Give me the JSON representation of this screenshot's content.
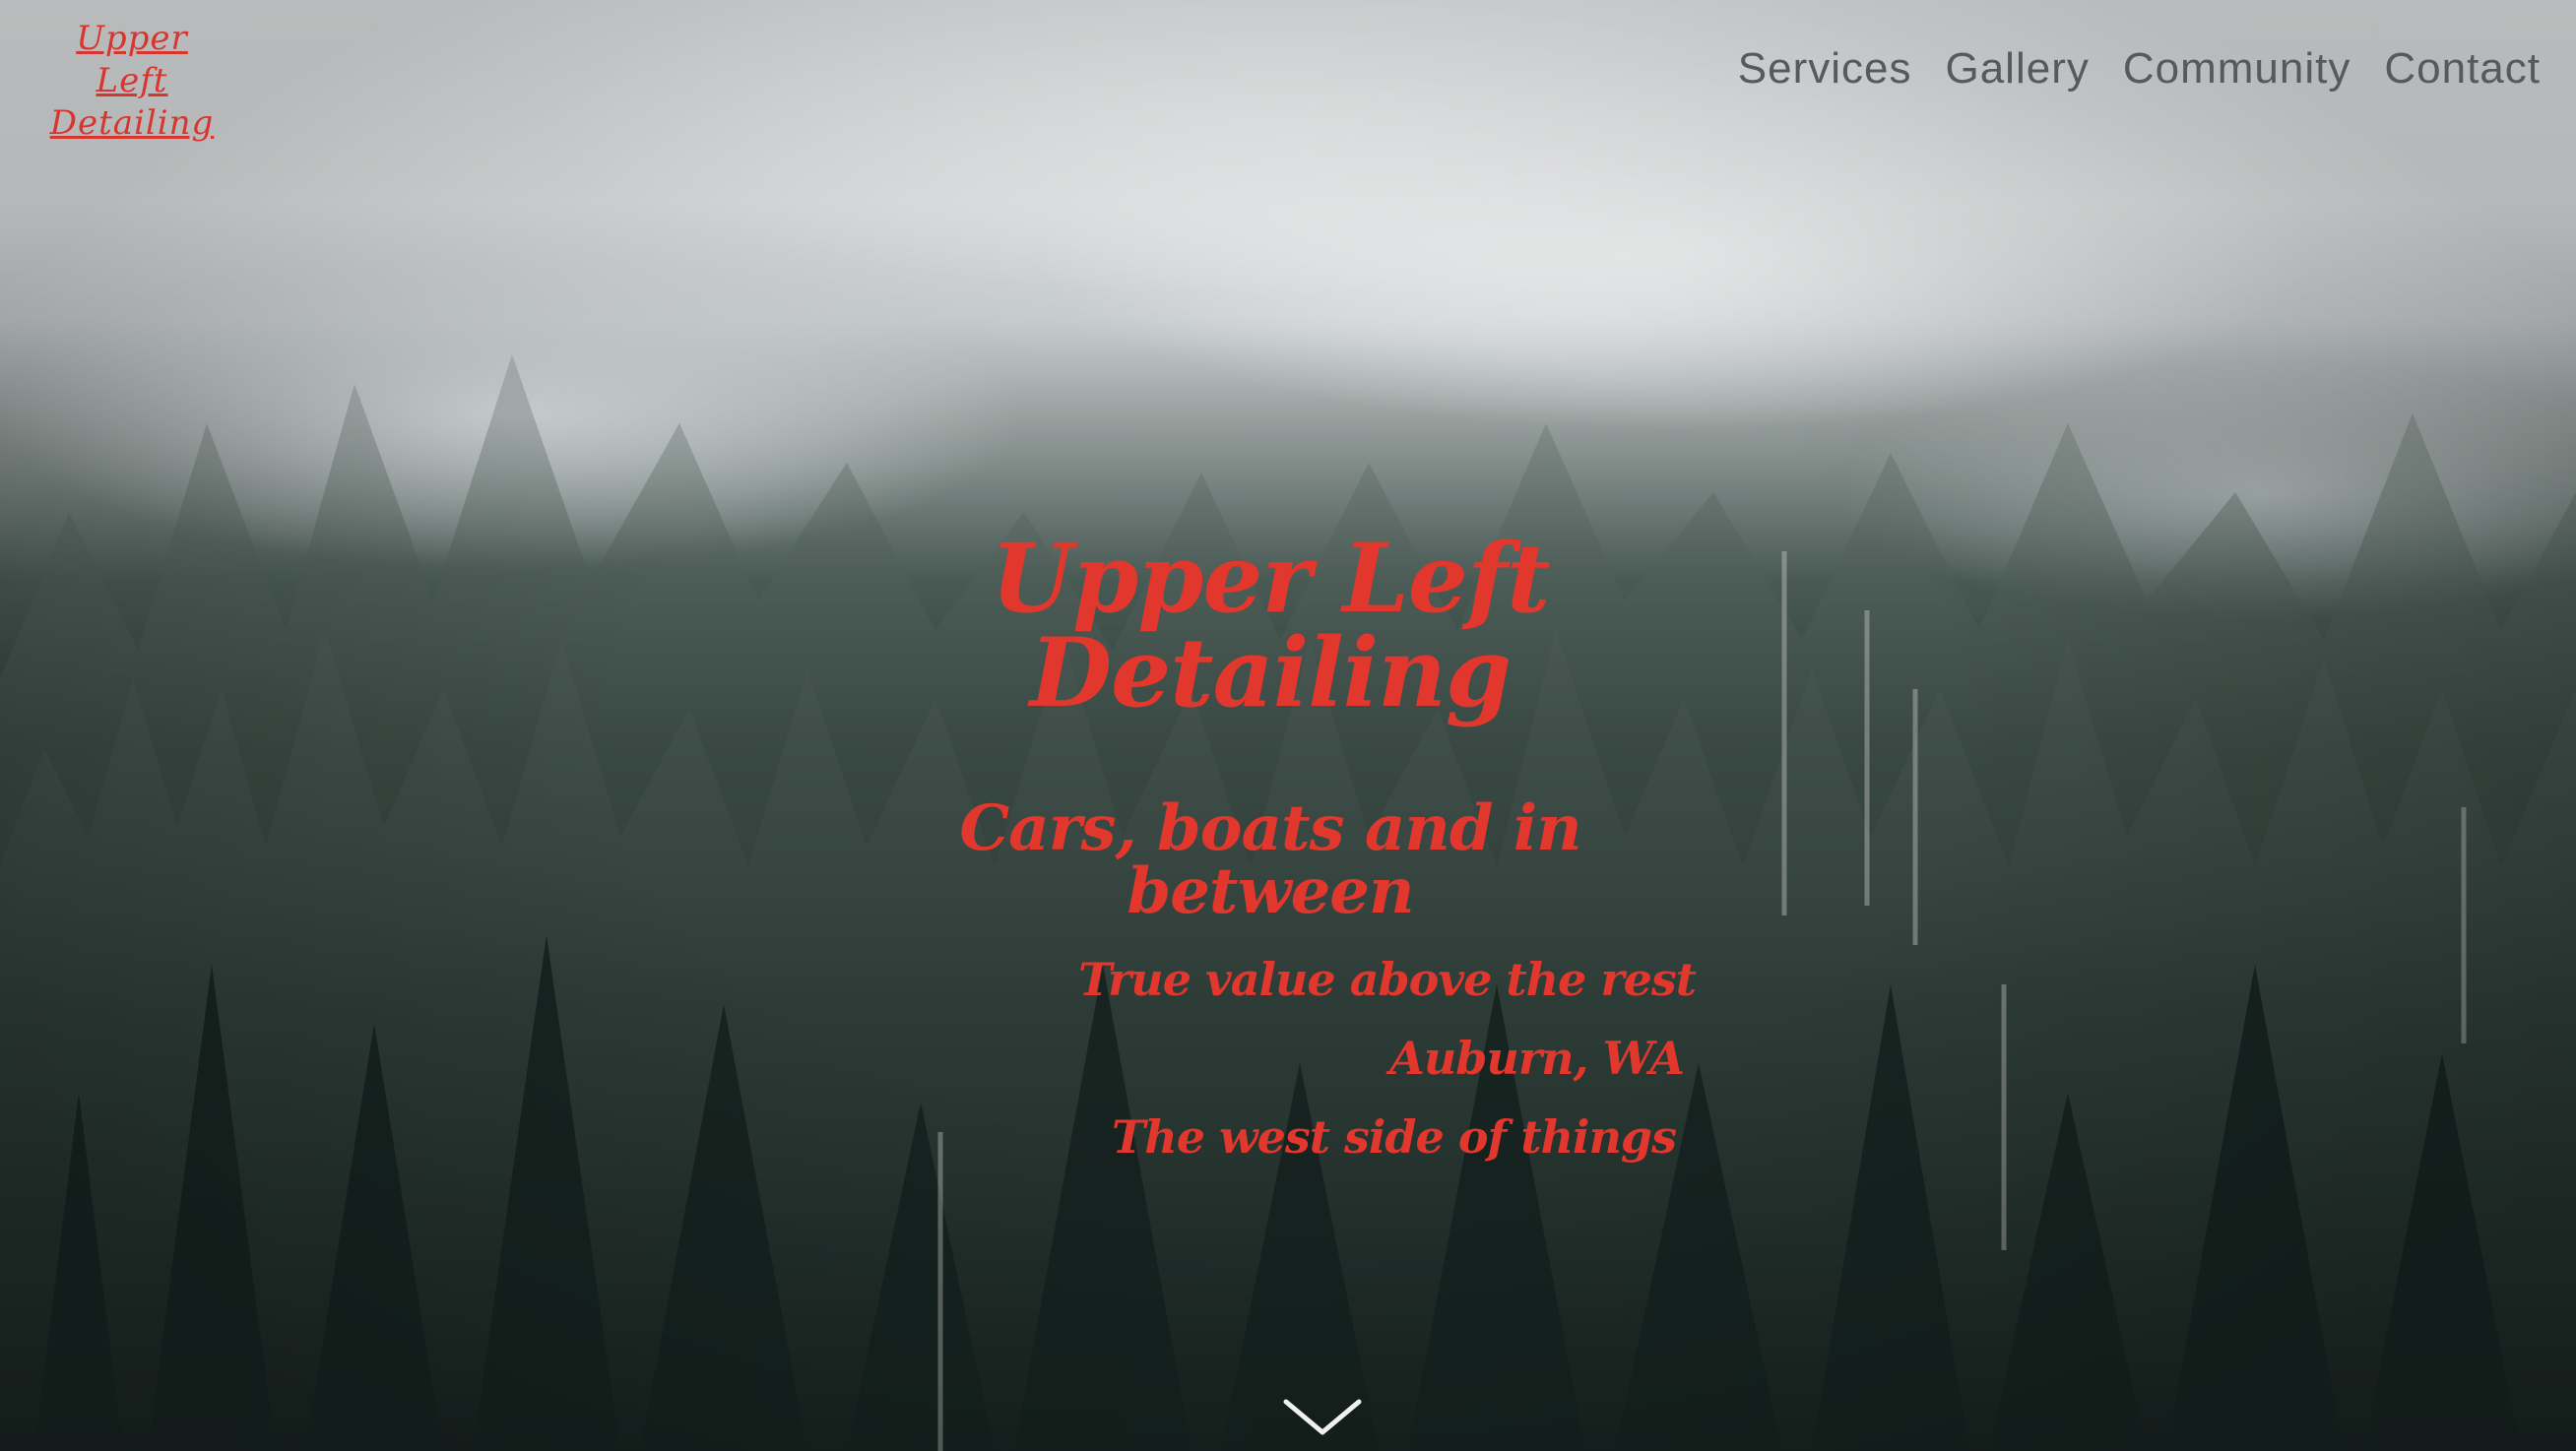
{
  "logo": {
    "lines": [
      "Upper",
      "Left",
      "Detailing"
    ]
  },
  "nav": {
    "items": [
      {
        "label": "Services"
      },
      {
        "label": "Gallery"
      },
      {
        "label": "Community"
      },
      {
        "label": "Contact"
      }
    ]
  },
  "hero": {
    "title": "Upper Left Detailing",
    "subtitle": "Cars, boats and in between",
    "tagline": "True value above the rest",
    "location": "Auburn, WA",
    "motto": "The west side of things"
  },
  "controls": {
    "scroll_icon": "chevron-down-icon"
  },
  "colors": {
    "accent": "#e1372d",
    "nav_text": "#555a5e",
    "chevron": "#f1f1f1"
  }
}
